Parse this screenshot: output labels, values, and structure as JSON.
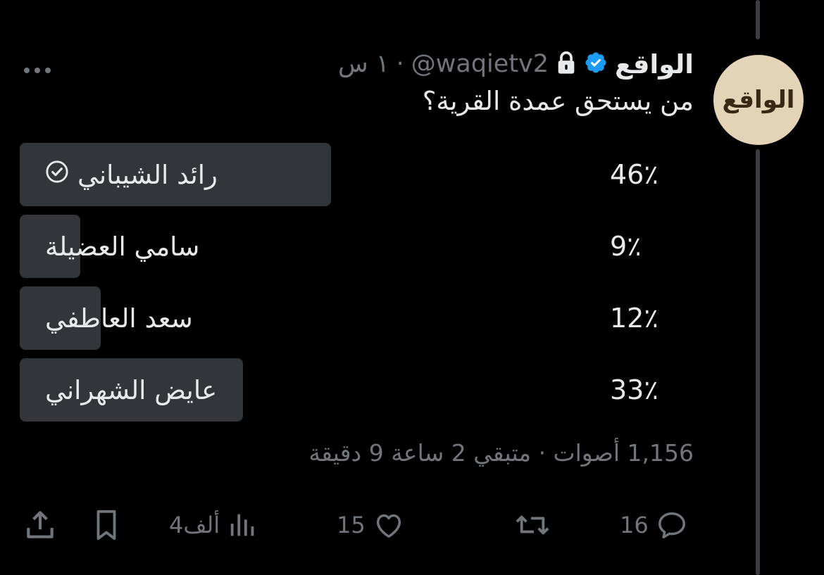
{
  "author": {
    "display_name": "الواقع",
    "handle": "@waqietv2",
    "time": "١ س",
    "avatar_text": "الواقع"
  },
  "separator": "·",
  "tweet": {
    "text": "من يستحق عمدة القرية؟"
  },
  "poll": {
    "options": [
      {
        "label": "رائد الشيباني",
        "percent_text": "46٪",
        "percent": 46,
        "winner": true
      },
      {
        "label": "سامي العضيلة",
        "percent_text": "9٪",
        "percent": 9,
        "winner": false
      },
      {
        "label": "سعد العاطفي",
        "percent_text": "12٪",
        "percent": 12,
        "winner": false
      },
      {
        "label": "عايض الشهراني",
        "percent_text": "33٪",
        "percent": 33,
        "winner": false
      }
    ],
    "meta": "1,156 أصوات · متبقي 2 ساعة 9 دقيقة"
  },
  "actions": {
    "replies": "16",
    "likes": "15",
    "views": "4ألف"
  },
  "colors": {
    "background": "#000000",
    "text": "#e7e9ea",
    "secondary": "#71767b",
    "poll_bar": "#333639",
    "verified": "#1d9bf0"
  },
  "icons": [
    "verified-badge-icon",
    "lock-icon",
    "more-icon",
    "check-circle-icon",
    "reply-icon",
    "retweet-icon",
    "like-icon",
    "views-icon",
    "bookmark-icon",
    "share-icon"
  ]
}
